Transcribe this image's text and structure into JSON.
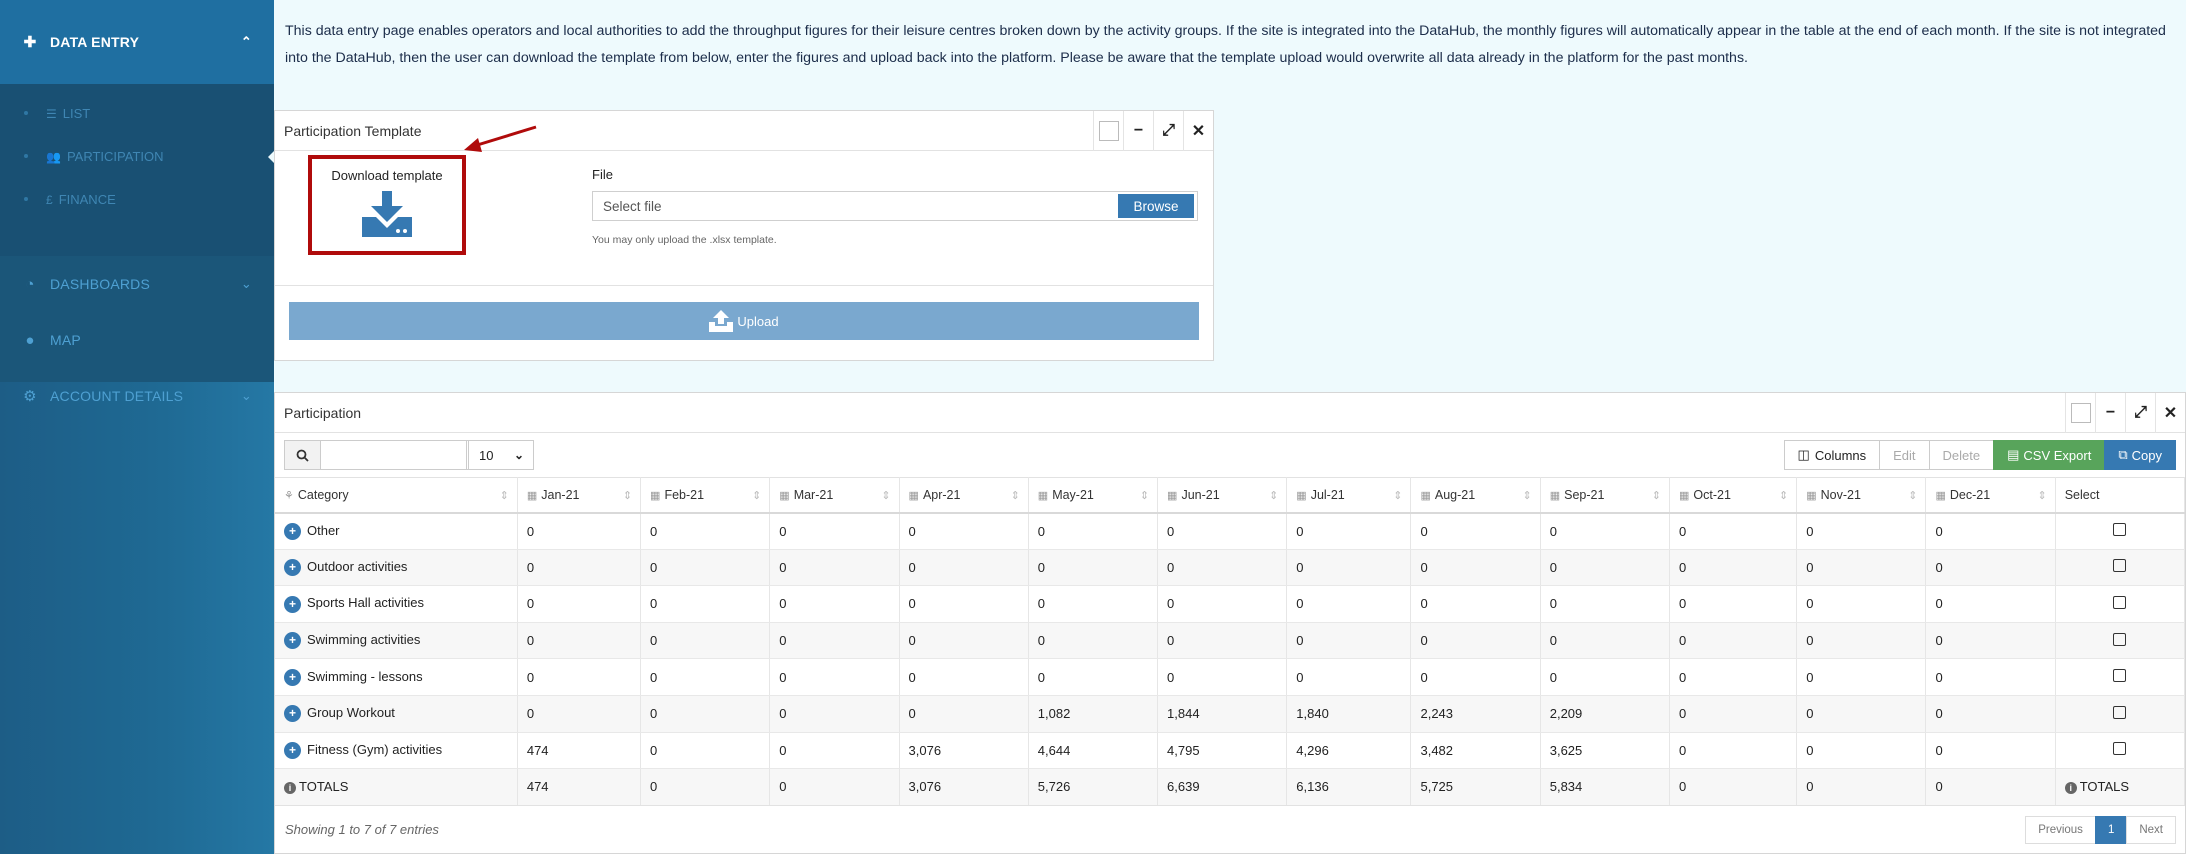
{
  "sidebar": {
    "data_entry": "DATA ENTRY",
    "list": "LIST",
    "participation": "PARTICIPATION",
    "finance": "FINANCE",
    "dashboards": "DASHBOARDS",
    "map": "MAP",
    "account_details": "ACCOUNT DETAILS"
  },
  "intro": "This data entry page enables operators and local authorities to add the throughput figures for their leisure centres broken down by the activity groups. If the site is integrated into the DataHub, the monthly figures will automatically appear in the table at the end of each month. If the site is not integrated into the DataHub, then the user can download the template from below, enter the figures and upload back into the platform. Please be aware that the template upload would overwrite all data already in the platform for the past months.",
  "template_panel": {
    "title": "Participation Template",
    "download_label": "Download template",
    "file_label": "File",
    "file_placeholder": "Select file",
    "browse": "Browse",
    "hint": "You may only upload the .xlsx template.",
    "upload": "Upload"
  },
  "participation_panel": {
    "title": "Participation",
    "page_size": "10",
    "buttons": {
      "columns": "Columns",
      "edit": "Edit",
      "delete": "Delete",
      "csv": "CSV Export",
      "copy": "Copy"
    },
    "columns": [
      "Category",
      "Jan-21",
      "Feb-21",
      "Mar-21",
      "Apr-21",
      "May-21",
      "Jun-21",
      "Jul-21",
      "Aug-21",
      "Sep-21",
      "Oct-21",
      "Nov-21",
      "Dec-21",
      "Select"
    ],
    "rows": [
      {
        "category": "Other",
        "values": [
          "0",
          "0",
          "0",
          "0",
          "0",
          "0",
          "0",
          "0",
          "0",
          "0",
          "0",
          "0"
        ]
      },
      {
        "category": "Outdoor activities",
        "values": [
          "0",
          "0",
          "0",
          "0",
          "0",
          "0",
          "0",
          "0",
          "0",
          "0",
          "0",
          "0"
        ]
      },
      {
        "category": "Sports Hall activities",
        "values": [
          "0",
          "0",
          "0",
          "0",
          "0",
          "0",
          "0",
          "0",
          "0",
          "0",
          "0",
          "0"
        ]
      },
      {
        "category": "Swimming activities",
        "values": [
          "0",
          "0",
          "0",
          "0",
          "0",
          "0",
          "0",
          "0",
          "0",
          "0",
          "0",
          "0"
        ]
      },
      {
        "category": "Swimming - lessons",
        "values": [
          "0",
          "0",
          "0",
          "0",
          "0",
          "0",
          "0",
          "0",
          "0",
          "0",
          "0",
          "0"
        ]
      },
      {
        "category": "Group Workout",
        "values": [
          "0",
          "0",
          "0",
          "0",
          "1,082",
          "1,844",
          "1,840",
          "2,243",
          "2,209",
          "0",
          "0",
          "0"
        ]
      },
      {
        "category": "Fitness (Gym) activities",
        "values": [
          "474",
          "0",
          "0",
          "3,076",
          "4,644",
          "4,795",
          "4,296",
          "3,482",
          "3,625",
          "0",
          "0",
          "0"
        ]
      }
    ],
    "totals": {
      "label": "TOTALS",
      "values": [
        "474",
        "0",
        "0",
        "3,076",
        "5,726",
        "6,639",
        "6,136",
        "5,725",
        "5,834",
        "0",
        "0",
        "0"
      ],
      "select_label": "TOTALS"
    },
    "showing": "Showing 1 to 7 of 7 entries",
    "pager": {
      "previous": "Previous",
      "page": "1",
      "next": "Next"
    }
  }
}
